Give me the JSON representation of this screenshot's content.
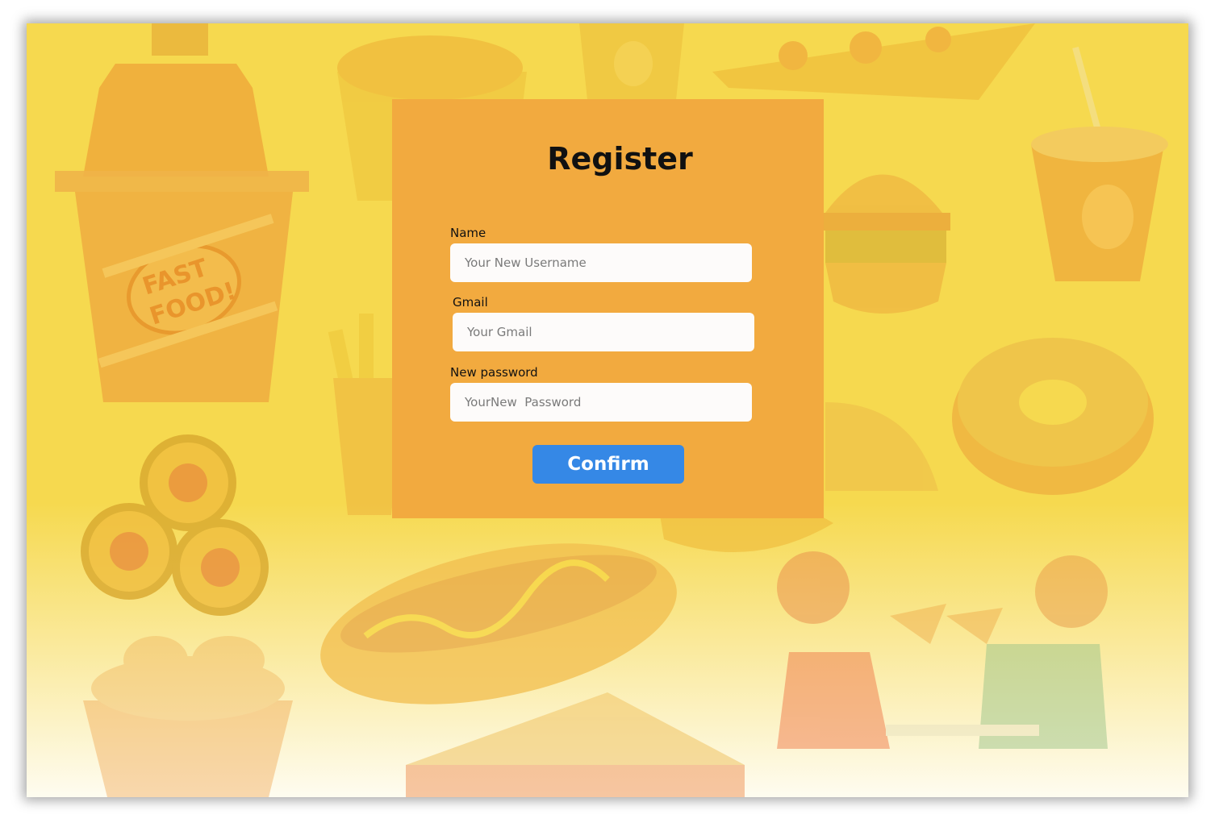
{
  "register": {
    "title": "Register",
    "name_label": "Name",
    "name_placeholder": "Your New Username",
    "gmail_label": "Gmail",
    "gmail_placeholder": "Your Gmail",
    "password_label": "New password",
    "password_placeholder": "YourNew  Password",
    "confirm_label": "Confirm"
  },
  "background": {
    "badge_text_1": "FAST",
    "badge_text_2": "FOOD!"
  },
  "colors": {
    "background": "#f6d94f",
    "card": "#f2aa3f",
    "button": "#3588e6",
    "input": "#fdfbfa"
  }
}
